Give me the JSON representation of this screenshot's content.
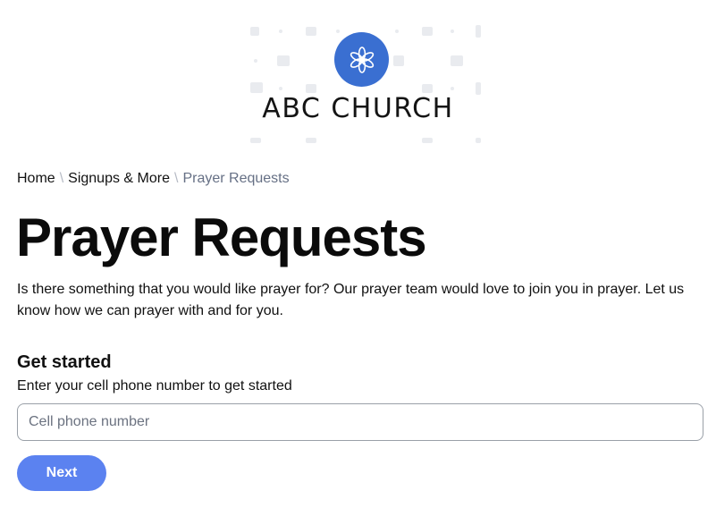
{
  "logo": {
    "name": "ABC CHURCH",
    "icon": "star-of-life-icon",
    "brand_color": "#3a6fd1"
  },
  "breadcrumb": {
    "items": [
      "Home",
      "Signups & More",
      "Prayer Requests"
    ],
    "separator": "\\"
  },
  "page": {
    "title": "Prayer Requests",
    "intro": "Is there something that you would like prayer for? Our prayer team would love to join you in prayer. Let us know how we can prayer with and for you."
  },
  "form": {
    "heading": "Get started",
    "instructions": "Enter your cell phone number to get started",
    "phone_placeholder": "Cell phone number",
    "phone_value": "",
    "next_label": "Next",
    "accent_color": "#5b82f0"
  }
}
